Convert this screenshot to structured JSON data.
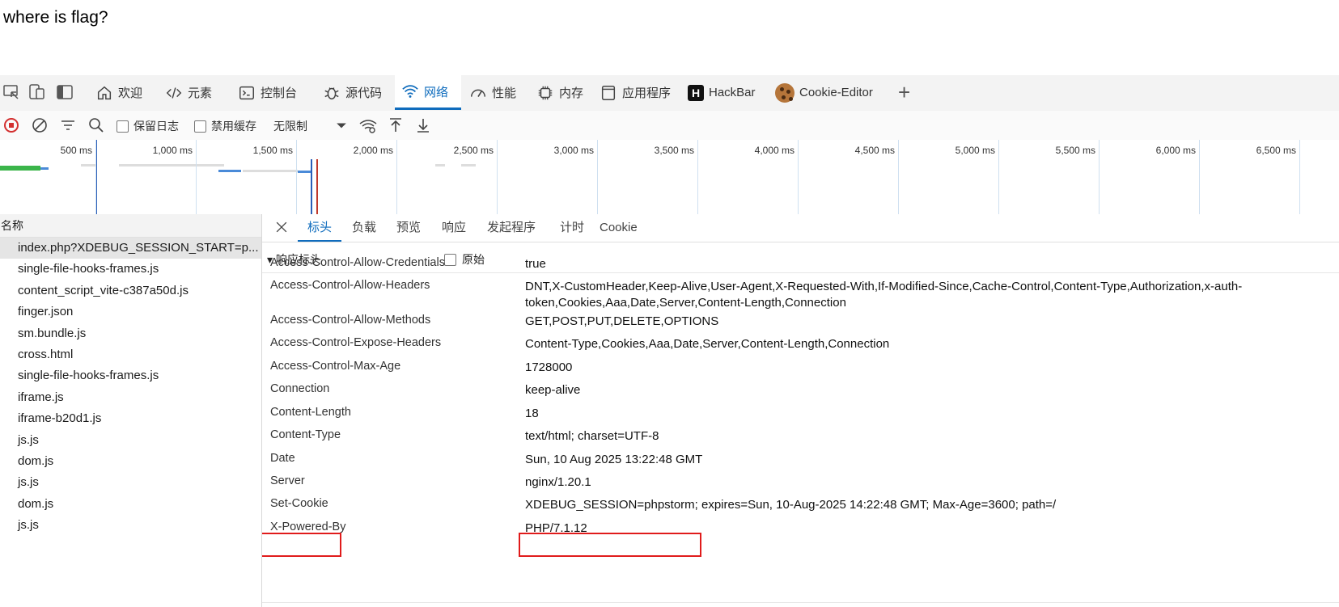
{
  "page": {
    "text": "where is flag?"
  },
  "devtools": {
    "tabs": [
      {
        "icon": "home-icon",
        "label": "欢迎"
      },
      {
        "icon": "code-icon",
        "label": "元素"
      },
      {
        "icon": "console-icon",
        "label": "控制台"
      },
      {
        "icon": "bug-icon",
        "label": "源代码"
      },
      {
        "icon": "wifi-icon",
        "label": "网络",
        "active": true
      },
      {
        "icon": "speedometer-icon",
        "label": "性能"
      },
      {
        "icon": "chip-icon",
        "label": "内存"
      },
      {
        "icon": "app-icon",
        "label": "应用程序"
      },
      {
        "icon": "hackbar-logo-icon",
        "label": "HackBar",
        "logo_text": "H"
      },
      {
        "icon": "cookie-icon",
        "label": "Cookie-Editor"
      }
    ],
    "add_tab_symbol": "+",
    "toolbar": {
      "preserve_log": "保留日志",
      "disable_cache": "禁用缓存",
      "throttling": "无限制"
    },
    "timeline_ticks": [
      "500 ms",
      "1,000 ms",
      "1,500 ms",
      "2,000 ms",
      "2,500 ms",
      "3,000 ms",
      "3,500 ms",
      "4,000 ms",
      "4,500 ms",
      "5,000 ms",
      "5,500 ms",
      "6,000 ms",
      "6,500 ms"
    ],
    "name_header": "名称",
    "requests": [
      "index.php?XDEBUG_SESSION_START=p...",
      "single-file-hooks-frames.js",
      "content_script_vite-c387a50d.js",
      "finger.json",
      "sm.bundle.js",
      "cross.html",
      "single-file-hooks-frames.js",
      "iframe.js",
      "iframe-b20d1.js",
      "js.js",
      "dom.js",
      "js.js",
      "dom.js",
      "js.js"
    ],
    "detail_tabs": [
      "标头",
      "负载",
      "预览",
      "响应",
      "发起程序",
      "计时",
      "Cookie"
    ],
    "section_title": "▾ 响应标头",
    "raw_label": "原始",
    "headers": [
      {
        "name": "Access-Control-Allow-Credentials",
        "value": "true"
      },
      {
        "name": "Access-Control-Allow-Headers",
        "value": "DNT,X-CustomHeader,Keep-Alive,User-Agent,X-Requested-With,If-Modified-Since,Cache-Control,Content-Type,Authorization,x-auth-token,Cookies,Aaa,Date,Server,Content-Length,Connection"
      },
      {
        "name": "Access-Control-Allow-Methods",
        "value": "GET,POST,PUT,DELETE,OPTIONS"
      },
      {
        "name": "Access-Control-Expose-Headers",
        "value": "Content-Type,Cookies,Aaa,Date,Server,Content-Length,Connection"
      },
      {
        "name": "Access-Control-Max-Age",
        "value": "1728000"
      },
      {
        "name": "Connection",
        "value": "keep-alive"
      },
      {
        "name": "Content-Length",
        "value": "18"
      },
      {
        "name": "Content-Type",
        "value": "text/html; charset=UTF-8"
      },
      {
        "name": "Date",
        "value": "Sun, 10 Aug 2025 13:22:48 GMT"
      },
      {
        "name": "Server",
        "value": "nginx/1.20.1"
      },
      {
        "name": "Set-Cookie",
        "value": "XDEBUG_SESSION=phpstorm; expires=Sun, 10-Aug-2025 14:22:48 GMT; Max-Age=3600; path=/"
      },
      {
        "name": "X-Powered-By",
        "value": "PHP/7.1.12"
      }
    ],
    "colors": {
      "accent": "#0f6cbd",
      "highlight": "#e01b1b"
    }
  }
}
